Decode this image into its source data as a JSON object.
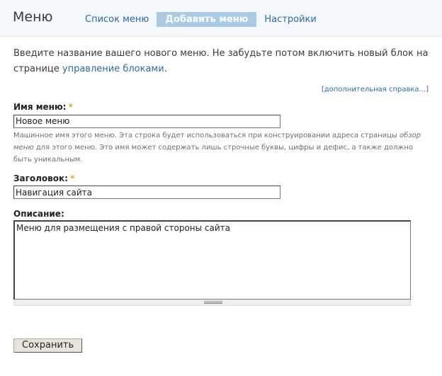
{
  "header": {
    "title": "Меню",
    "tabs": [
      {
        "label": "Список меню",
        "active": false
      },
      {
        "label": "Добавить меню",
        "active": true
      },
      {
        "label": "Настройки",
        "active": false
      }
    ]
  },
  "intro": {
    "text_before": "Введите название вашего нового меню. Не забудьте потом включить новый блок на странице ",
    "link": "управление блоками",
    "text_after": "."
  },
  "help_link": "[дополнительная справка...]",
  "form": {
    "menu_name": {
      "label": "Имя меню:",
      "required_mark": "*",
      "value": "Новое меню",
      "description_part1": "Машинное имя этого меню. Эта строка будет использоваться при конструировании адреса страницы ",
      "description_em": "обзор меню",
      "description_part2": " для этого меню. Это имя может содержать лишь строчные буквы, цифры и дефис, а также должно быть уникальным."
    },
    "title": {
      "label": "Заголовок:",
      "required_mark": "*",
      "value": "Навигация сайта"
    },
    "description": {
      "label": "Описание:",
      "value": "Меню для размещения с правой стороны сайта"
    },
    "save_label": "Сохранить"
  },
  "colors": {
    "link": "#2b6aa8",
    "active_tab_bg": "#a9cbe6",
    "required": "#f0a020"
  }
}
